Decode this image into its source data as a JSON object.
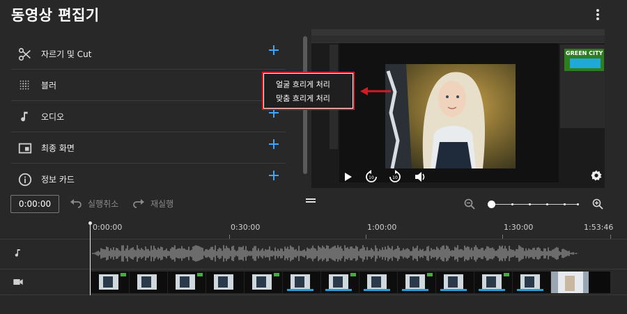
{
  "header": {
    "title": "동영상 편집기",
    "menu_icon": "more-vert-icon"
  },
  "features": [
    {
      "icon": "scissors-icon",
      "label": "자르기 및 Cut"
    },
    {
      "icon": "blur-grid-icon",
      "label": "블러"
    },
    {
      "icon": "music-note-icon",
      "label": "오디오"
    },
    {
      "icon": "end-screen-icon",
      "label": "최종 화면"
    },
    {
      "icon": "info-icon",
      "label": "정보 카드"
    }
  ],
  "blur_menu": {
    "items": [
      "얼굴 흐리게 처리",
      "맞춤 흐리게 처리"
    ],
    "highlight_color": "#d01c22"
  },
  "preview": {
    "overlay_logo": "GREEN CITY"
  },
  "toolbar": {
    "time": "0:00:00",
    "undo_label": "실행취소",
    "redo_label": "재실행"
  },
  "zoom": {
    "level": 0.0
  },
  "timeline": {
    "ticks": [
      "0:00:00",
      "0:30:00",
      "1:00:00",
      "1:30:00",
      "1:53:46"
    ],
    "playhead": "0:00:00"
  },
  "colors": {
    "accent": "#3ea6ff",
    "background": "#282828"
  }
}
